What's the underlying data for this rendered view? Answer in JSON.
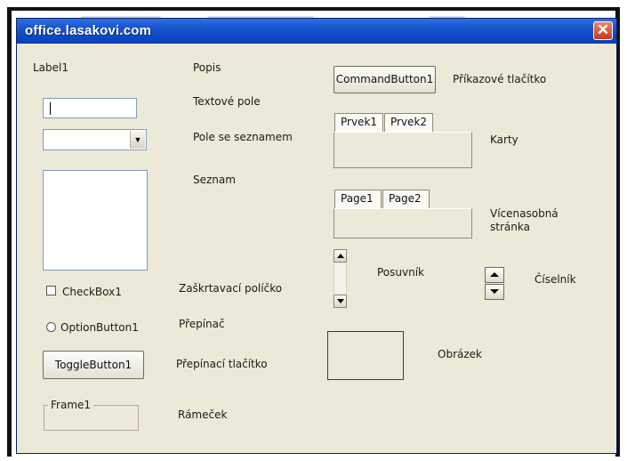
{
  "window": {
    "title": "office.lasakovi.com",
    "close_glyph": "✕"
  },
  "form": {
    "label1": "Label1",
    "popis": "Popis",
    "textove_pole": "Textové pole",
    "pole_se_seznamem": "Pole se seznamem",
    "seznam": "Seznam",
    "checkbox_label": "CheckBox1",
    "checkbox_desc": "Zaškrtavací políčko",
    "option_label": "OptionButton1",
    "option_desc": "Přepínač",
    "toggle_label": "ToggleButton1",
    "toggle_desc": "Přepínací tlačítko",
    "frame_caption": "Frame1",
    "frame_desc": "Rámeček",
    "command_label": "CommandButton1",
    "command_desc": "Příkazové tlačítko",
    "tabstrip_tabs": [
      "Prvek1",
      "Prvek2"
    ],
    "tabstrip_desc": "Karty",
    "multipage_tabs": [
      "Page1",
      "Page2"
    ],
    "multipage_desc_line1": "Vícenasobná",
    "multipage_desc_line2": "stránka",
    "scrollbar_desc": "Posuvník",
    "spin_desc": "Číselník",
    "image_desc": "Obrázek"
  },
  "colors": {
    "titlebar": "#0b47c2",
    "dialog_bg": "#ece9d8",
    "close_button": "#c63b1a"
  }
}
